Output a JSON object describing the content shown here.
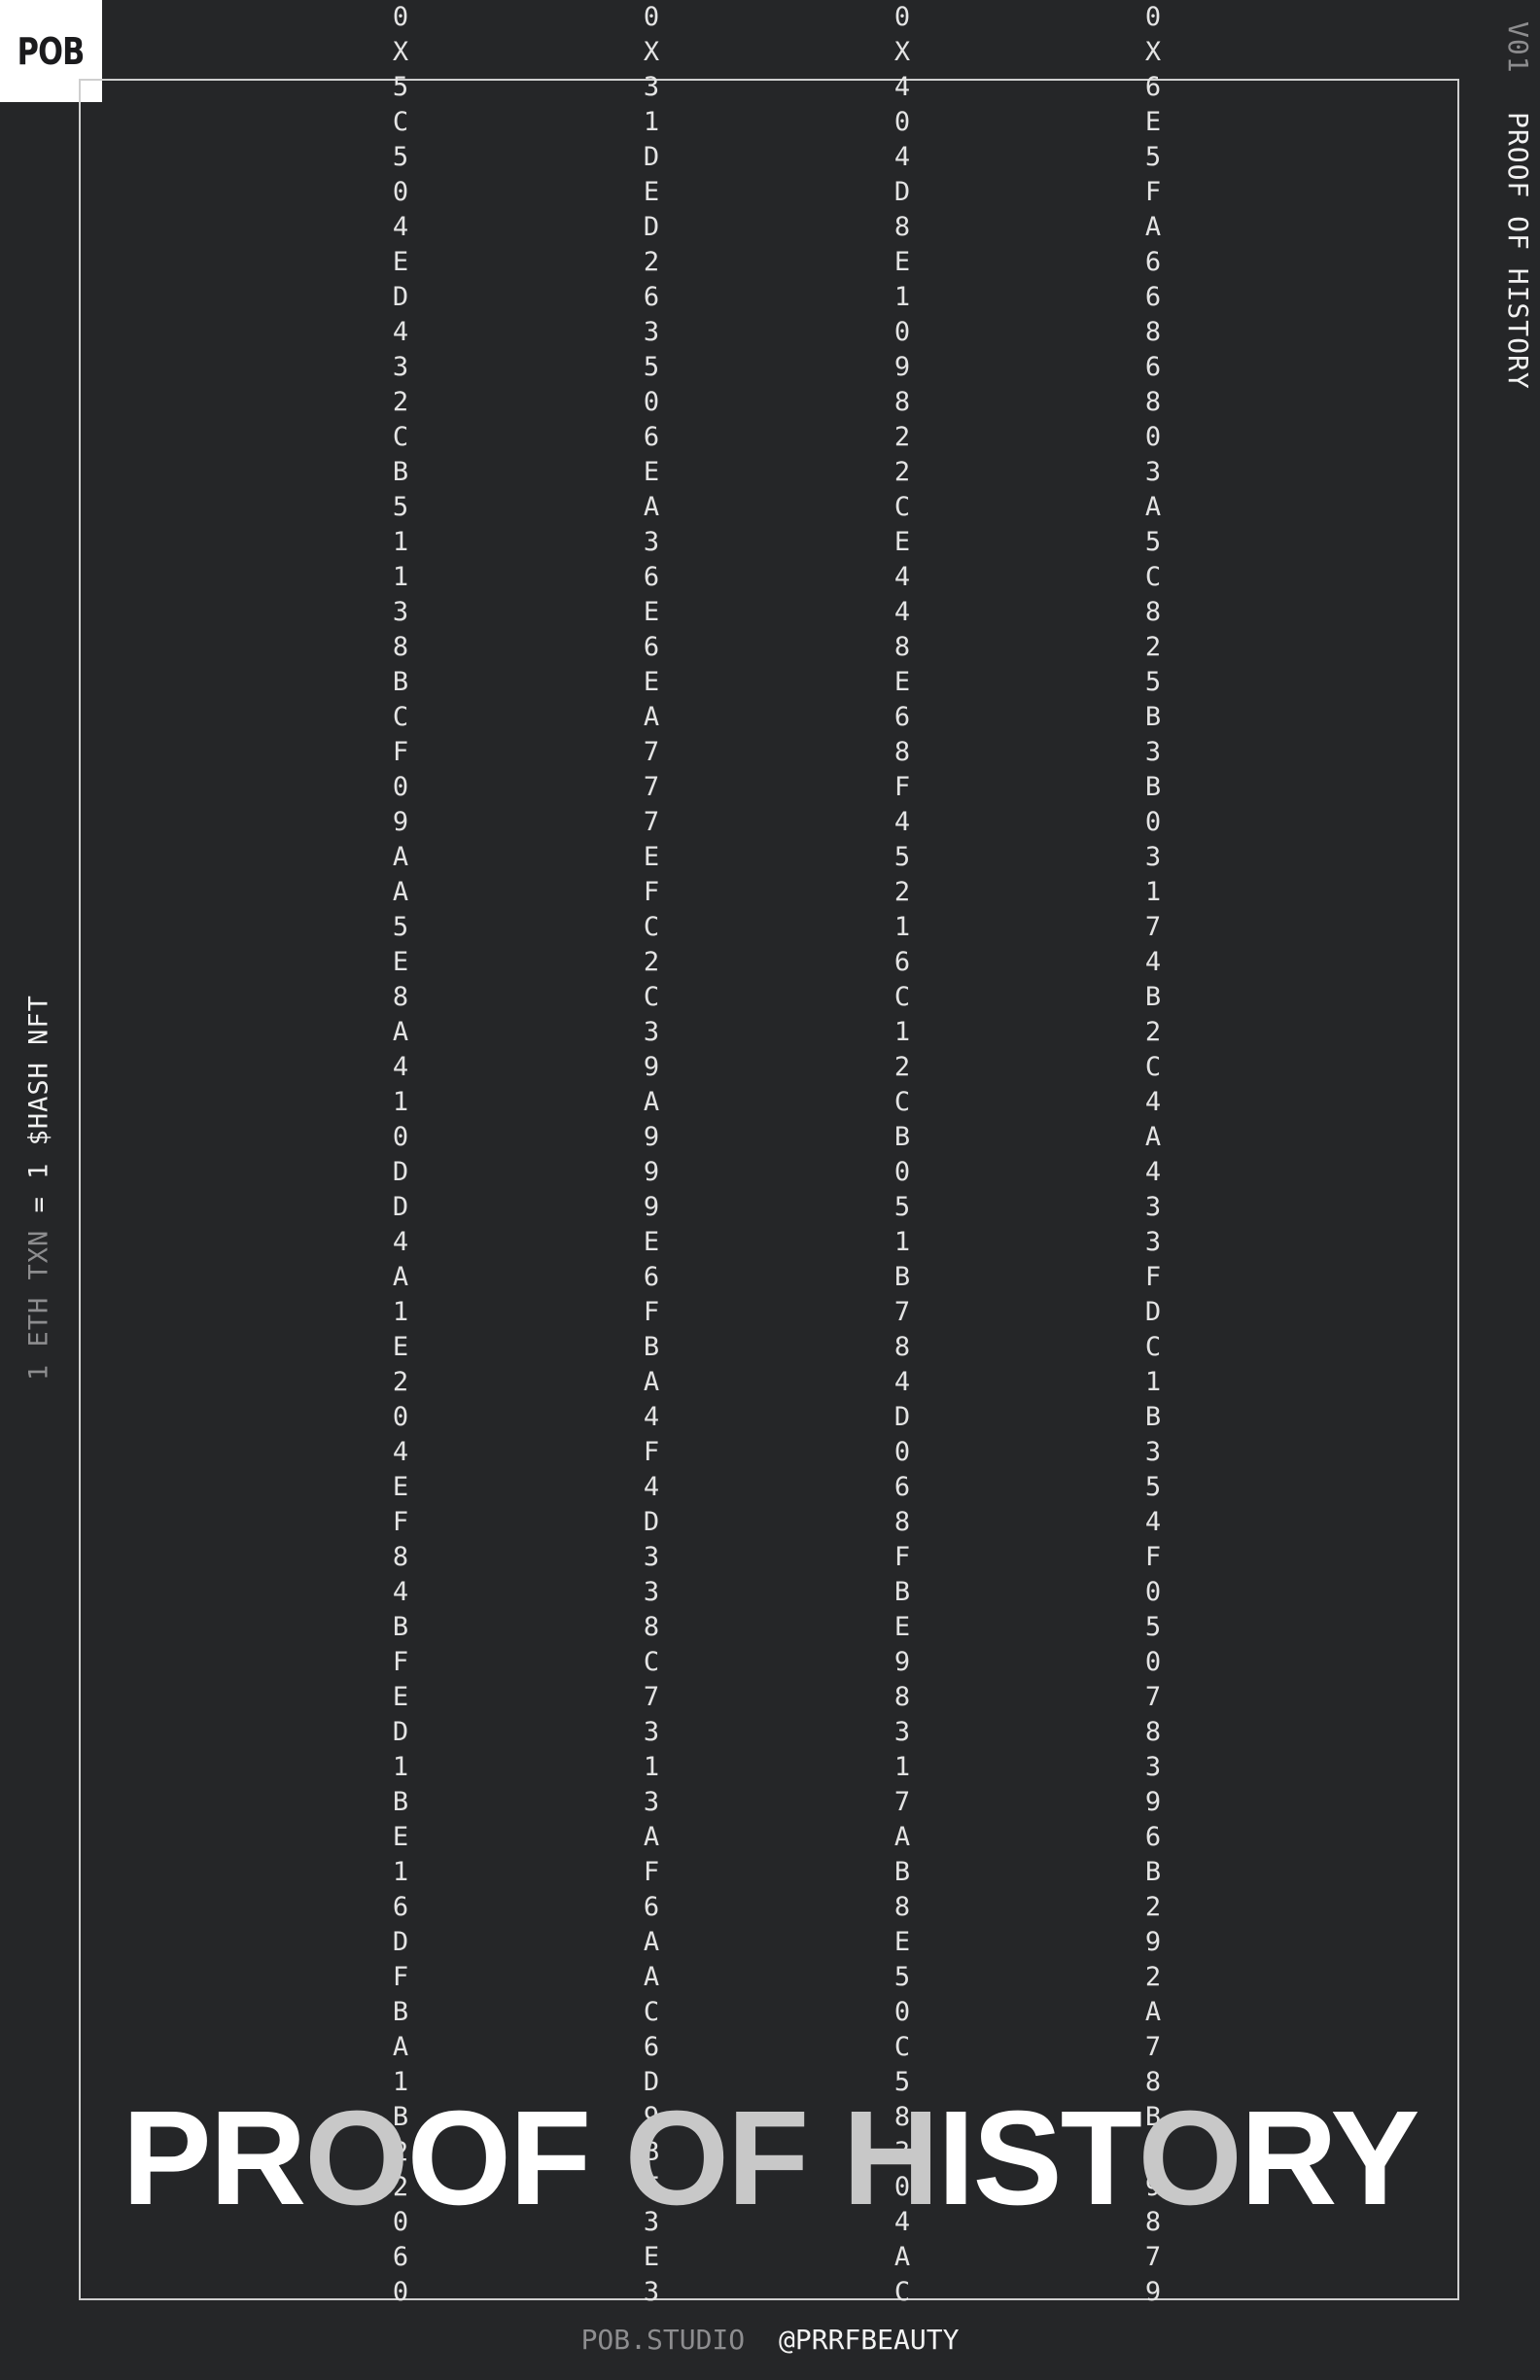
{
  "logo": {
    "text": "POB"
  },
  "header_right": {
    "version": "V01",
    "title": "PROOF OF HISTORY"
  },
  "left_caption": {
    "dim": "1 ETH TXN",
    "lit": "= 1 $HASH NFT"
  },
  "hashes": [
    "0X5C504ED432CB51138BCF09AA5E8A410DD4A1E204EF84BFED1BE16DFBA1B22060",
    "0X31DED26350 6EA36E6EA777EFC2C39A999E6FBA4F4D338C7313AF6AAC6D9BF3E3",
    "0X404D8E109822CE448E68F4521 6C12CB051B784D068FBE98317AB8E50C5830 4AC",
    "0X6E5FA668680 3A5C825B3B0317 4B2C4A433FDC1B354F0507839 6B292A78B49879"
  ],
  "title": {
    "parts": [
      {
        "text": "PR",
        "tone": "w"
      },
      {
        "text": "O",
        "tone": "g"
      },
      {
        "text": "OF ",
        "tone": "w"
      },
      {
        "text": "OF ",
        "tone": "g"
      },
      {
        "text": "H",
        "tone": "g"
      },
      {
        "text": "IST",
        "tone": "w"
      },
      {
        "text": "O",
        "tone": "g"
      },
      {
        "text": "RY",
        "tone": "w"
      }
    ]
  },
  "footer": {
    "studio": "POB.STUDIO",
    "handle": "@PRRFBEAUTY"
  },
  "colors": {
    "background": "#252628",
    "frame": "#cfcfcf",
    "text": "#ffffff",
    "muted": "#8d8d8f"
  }
}
